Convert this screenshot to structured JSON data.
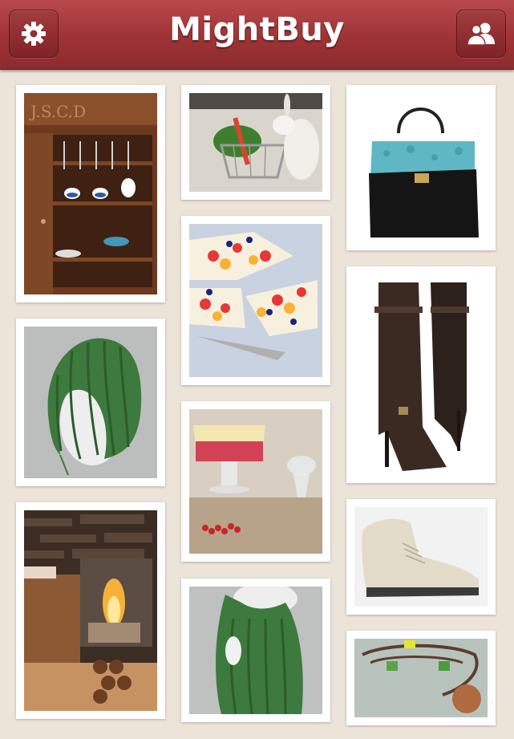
{
  "app": {
    "title": "MightBuy"
  },
  "navbar": {
    "left_icon": "gear-icon",
    "right_icon": "friends-icon"
  },
  "colors": {
    "navbar": "#9e3336",
    "background": "#ece4d9",
    "card": "#ffffff"
  },
  "feed": {
    "items": [
      {
        "subject": "wooden kitchen hutch with spoons and crockery",
        "column": 1
      },
      {
        "subject": "green ruffled bonnet on mannequin head",
        "column": 1
      },
      {
        "subject": "glass fireplace with logs",
        "column": 1
      },
      {
        "subject": "rabbit pushing shopping cart with vegetables",
        "column": 2
      },
      {
        "subject": "fruit tart slices",
        "column": 2
      },
      {
        "subject": "layered dessert with berries",
        "column": 2
      },
      {
        "subject": "green ruffled bonnet back view",
        "column": 2
      },
      {
        "subject": "turquoise snakeskin and black handbag",
        "column": 3
      },
      {
        "subject": "brown knee high heeled boots",
        "column": 3
      },
      {
        "subject": "beige suede chukka shoe",
        "column": 3
      },
      {
        "subject": "necklace with dream charm",
        "column": 3
      }
    ]
  }
}
